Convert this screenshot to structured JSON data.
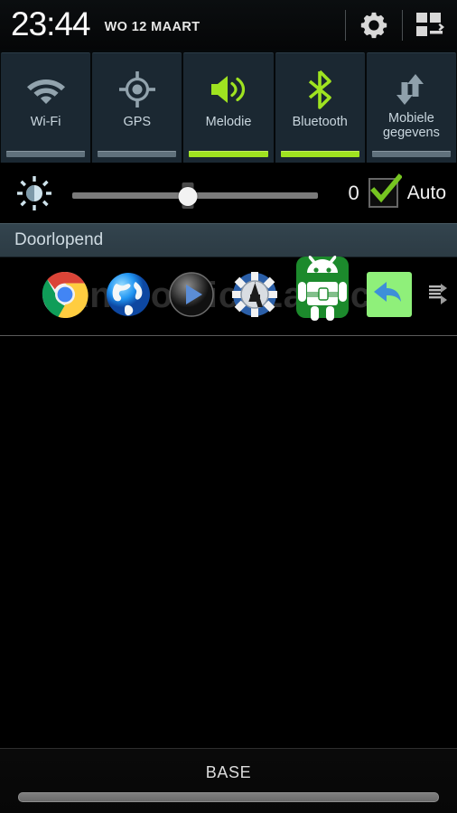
{
  "statusbar": {
    "time": "23:44",
    "date": "WO 12 MAART",
    "settings_icon": "gear-icon",
    "quick_panel_icon": "quick-settings-grid-icon"
  },
  "quick_toggles": [
    {
      "label": "Wi-Fi",
      "icon": "wifi-icon",
      "active": false
    },
    {
      "label": "GPS",
      "icon": "gps-target-icon",
      "active": false
    },
    {
      "label": "Melodie",
      "icon": "speaker-sound-icon",
      "active": true
    },
    {
      "label": "Bluetooth",
      "icon": "bluetooth-icon",
      "active": true
    },
    {
      "label": "Mobiele gegevens",
      "icon": "data-arrows-icon",
      "active": false
    }
  ],
  "brightness": {
    "icon": "brightness-sun-icon",
    "value": "0",
    "slider_percent": 47,
    "auto_label": "Auto",
    "auto_checked": true,
    "check_icon": "checkmark-icon"
  },
  "notifications": {
    "section_title": "Doorlopend",
    "watermark": "AndroidicaLaunch",
    "items": [
      {
        "icon": "chrome-icon",
        "label": "Chrome"
      },
      {
        "icon": "browser-globe-icon",
        "label": "Internet"
      },
      {
        "icon": "media-play-icon",
        "label": "Media Player"
      },
      {
        "icon": "poker-chip-icon",
        "label": "Poker"
      },
      {
        "icon": "android-robot-icon",
        "label": "Android"
      },
      {
        "icon": "back-arrow-icon",
        "label": "Back"
      },
      {
        "icon": "overflow-more-icon",
        "label": "More"
      }
    ]
  },
  "footer": {
    "carrier": "BASE",
    "drag_handle": "panel-drag-handle"
  },
  "colors": {
    "accent_green": "#9fe320",
    "tile_bg": "#1b2832",
    "tile_label": "#c9d6de",
    "section_bg": "#33444e",
    "bar_off": "#60717c"
  }
}
